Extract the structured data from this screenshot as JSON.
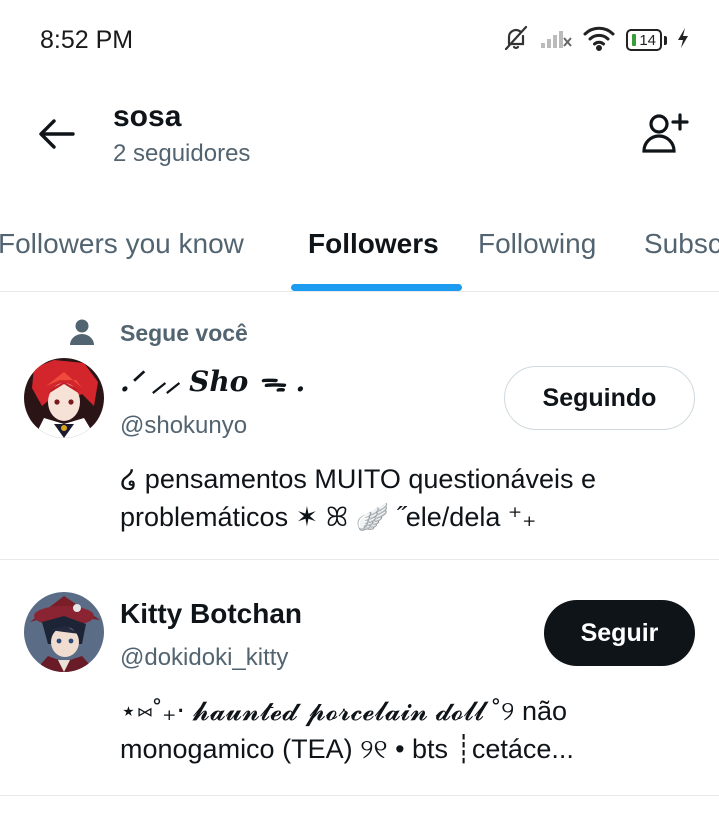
{
  "status_bar": {
    "time": "8:52 PM",
    "battery_level": "14",
    "icons": [
      "bell-off-icon",
      "signal-off-icon",
      "wifi-icon",
      "battery-icon",
      "charging-icon"
    ]
  },
  "header": {
    "title": "sosa",
    "subtitle": "2 seguidores",
    "back_icon": "arrow-left-icon",
    "add_icon": "add-user-icon"
  },
  "tabs": [
    {
      "label": "Followers you know",
      "active": false
    },
    {
      "label": "Followers",
      "active": true
    },
    {
      "label": "Following",
      "active": false
    },
    {
      "label": "Subscriptions",
      "active": false
    }
  ],
  "accent_color": "#1d9bf0",
  "users": [
    {
      "context": "Segue você",
      "display_name": ".ᐟ ⸝⸝ Sho ᯓ .",
      "handle": "@shokunyo",
      "button_label": "Seguindo",
      "following": true,
      "bio_line_1": "໒  pensamentos MUITO questionáveis e",
      "bio_line_2": "problemáticos ✶  ꕤ   🪽   ˝ele/dela  ⁺₊"
    },
    {
      "display_name": "Kitty Botchan",
      "handle": "@dokidoki_kitty",
      "button_label": "Seguir",
      "following": false,
      "bio_line_1": "⋆⑅˚₊‧ 𝓱𝓪𝓾𝓷𝓽𝓮𝓭 𝓹𝓸𝓻𝓬𝓮𝓵𝓪𝓲𝓷 𝓭𝓸𝓵𝓵 ˚୨ não",
      "bio_line_2": "monogamico (TEA)  ୨୧ •    bts ┊cetáce..."
    }
  ]
}
